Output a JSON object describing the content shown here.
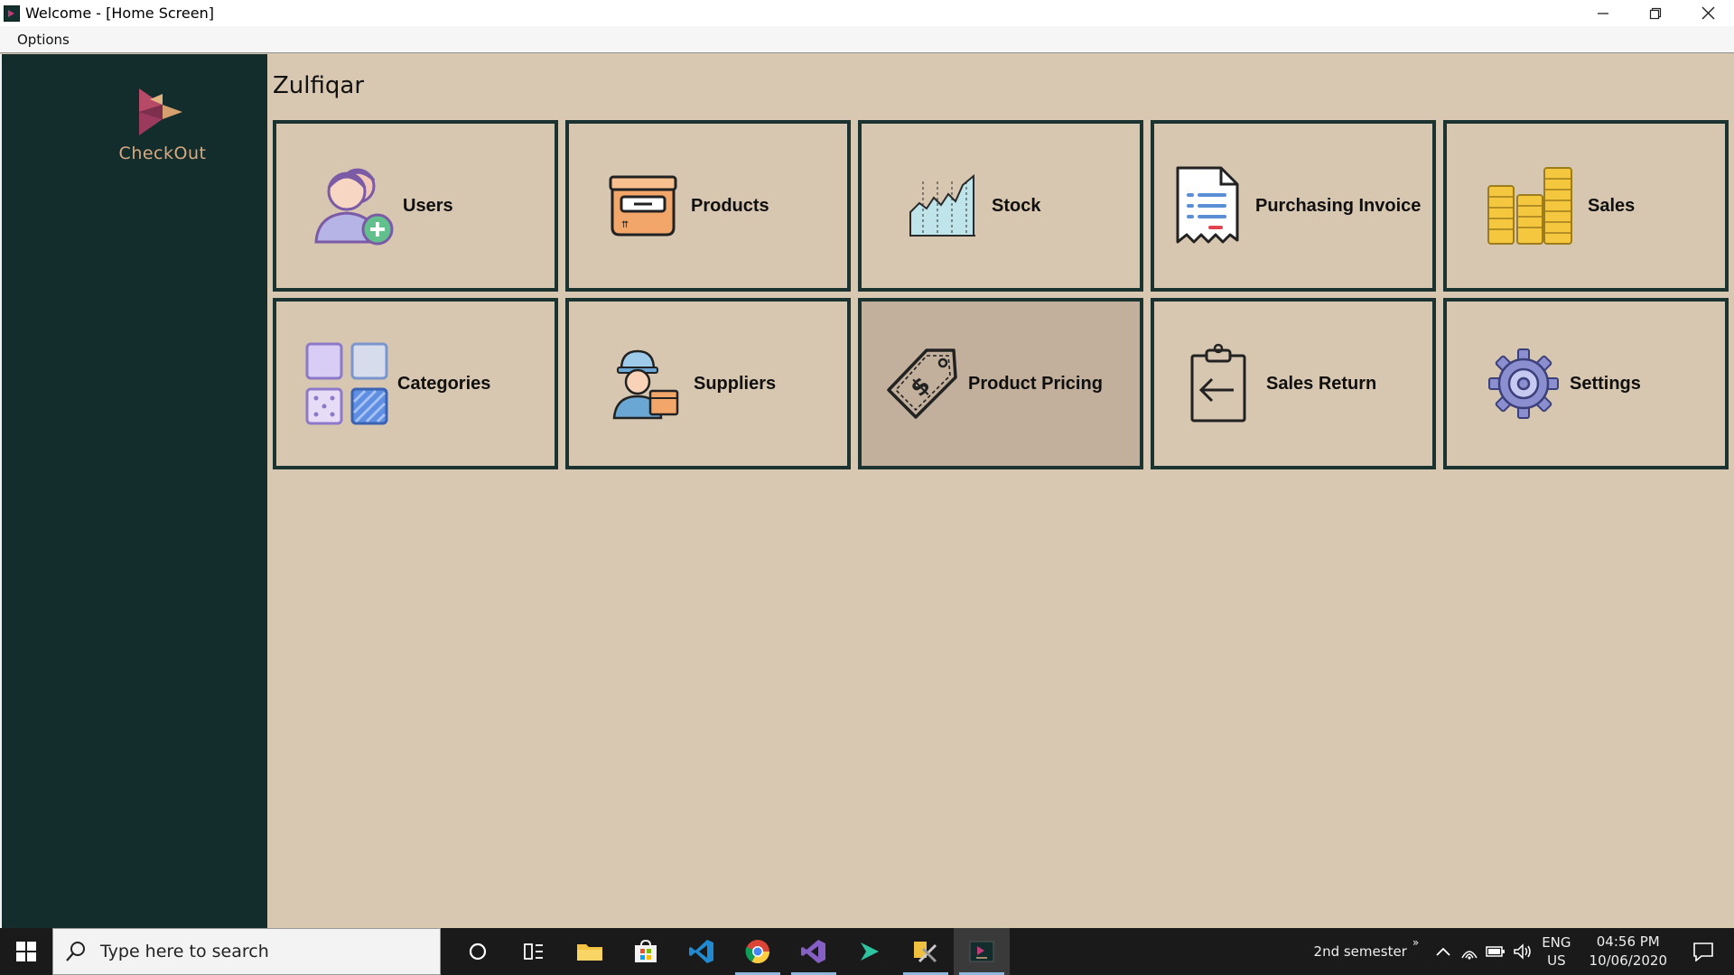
{
  "window": {
    "title": "Welcome - [Home Screen]",
    "controls": [
      "minimize",
      "restore",
      "close"
    ]
  },
  "menubar": {
    "items": [
      {
        "label": "Options"
      }
    ]
  },
  "sidebar": {
    "logo_text": "CheckOut"
  },
  "main": {
    "user_name": "Zulfiqar",
    "tiles": [
      {
        "label": "Users",
        "icon": "users-add-icon"
      },
      {
        "label": "Products",
        "icon": "product-box-icon"
      },
      {
        "label": "Stock",
        "icon": "stock-chart-icon"
      },
      {
        "label": "Purchasing Invoice",
        "icon": "invoice-icon"
      },
      {
        "label": "Sales",
        "icon": "coins-icon"
      },
      {
        "label": "Categories",
        "icon": "categories-icon"
      },
      {
        "label": "Suppliers",
        "icon": "supplier-icon"
      },
      {
        "label": "Product Pricing",
        "icon": "price-tag-icon",
        "highlighted": true
      },
      {
        "label": "Sales Return",
        "icon": "clipboard-return-icon"
      },
      {
        "label": "Settings",
        "icon": "gear-icon"
      }
    ]
  },
  "taskbar": {
    "search_placeholder": "Type here to search",
    "apps": [
      "cortana-icon",
      "task-view-icon",
      "file-explorer-icon",
      "store-icon",
      "vscode-icon",
      "chrome-icon",
      "visual-studio-icon",
      "app-green-icon",
      "tools-app-icon",
      "checkout-app-icon"
    ],
    "tray": {
      "folder_label": "2nd semester",
      "language": "ENG",
      "region": "US",
      "time": "04:56 PM",
      "date": "10/06/2020"
    }
  },
  "colors": {
    "sidebar_bg": "#122d2c",
    "main_bg": "#d9c8b1",
    "tile_border": "#1c3431",
    "tile_active_bg": "#c2b09c",
    "logo_text": "#d9a97f"
  }
}
